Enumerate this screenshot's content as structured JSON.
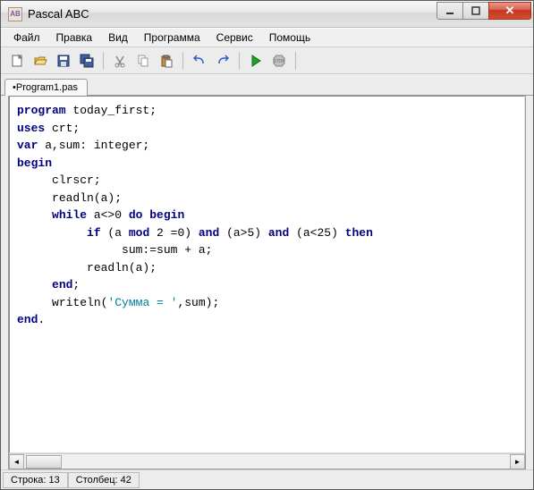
{
  "window": {
    "title": "Pascal ABC",
    "icon_text": "AB"
  },
  "menu": {
    "items": [
      "Файл",
      "Правка",
      "Вид",
      "Программа",
      "Сервис",
      "Помощь"
    ]
  },
  "tabs": {
    "active": "•Program1.pas"
  },
  "code": {
    "lines": [
      {
        "indent": 0,
        "parts": [
          {
            "t": "kw",
            "v": "program"
          },
          {
            "t": "plain",
            "v": " today_first;"
          }
        ]
      },
      {
        "indent": 0,
        "parts": [
          {
            "t": "kw",
            "v": "uses"
          },
          {
            "t": "plain",
            "v": " crt;"
          }
        ]
      },
      {
        "indent": 0,
        "parts": [
          {
            "t": "kw",
            "v": "var"
          },
          {
            "t": "plain",
            "v": " a,sum: integer;"
          }
        ]
      },
      {
        "indent": 0,
        "parts": [
          {
            "t": "kw",
            "v": "begin"
          }
        ]
      },
      {
        "indent": 1,
        "parts": [
          {
            "t": "plain",
            "v": "clrscr;"
          }
        ]
      },
      {
        "indent": 1,
        "parts": [
          {
            "t": "plain",
            "v": "readln(a);"
          }
        ]
      },
      {
        "indent": 1,
        "parts": [
          {
            "t": "kw",
            "v": "while"
          },
          {
            "t": "plain",
            "v": " a<>0 "
          },
          {
            "t": "kw",
            "v": "do begin"
          }
        ]
      },
      {
        "indent": 2,
        "parts": [
          {
            "t": "kw",
            "v": "if"
          },
          {
            "t": "plain",
            "v": " (a "
          },
          {
            "t": "kw",
            "v": "mod"
          },
          {
            "t": "plain",
            "v": " 2 =0) "
          },
          {
            "t": "kw",
            "v": "and"
          },
          {
            "t": "plain",
            "v": " (a>5) "
          },
          {
            "t": "kw",
            "v": "and"
          },
          {
            "t": "plain",
            "v": " (a<25) "
          },
          {
            "t": "kw",
            "v": "then"
          }
        ]
      },
      {
        "indent": 3,
        "parts": [
          {
            "t": "plain",
            "v": "sum:=sum + a;"
          }
        ]
      },
      {
        "indent": 2,
        "parts": [
          {
            "t": "plain",
            "v": "readln(a);"
          }
        ]
      },
      {
        "indent": 1,
        "parts": [
          {
            "t": "kw",
            "v": "end"
          },
          {
            "t": "plain",
            "v": ";"
          }
        ]
      },
      {
        "indent": 1,
        "parts": [
          {
            "t": "plain",
            "v": "writeln("
          },
          {
            "t": "str",
            "v": "'Сумма = '"
          },
          {
            "t": "plain",
            "v": ",sum);"
          }
        ]
      },
      {
        "indent": 0,
        "parts": [
          {
            "t": "kw",
            "v": "end"
          },
          {
            "t": "plain",
            "v": "."
          }
        ]
      }
    ]
  },
  "status": {
    "line_label": "Строка: 13",
    "col_label": "Столбец: 42"
  }
}
